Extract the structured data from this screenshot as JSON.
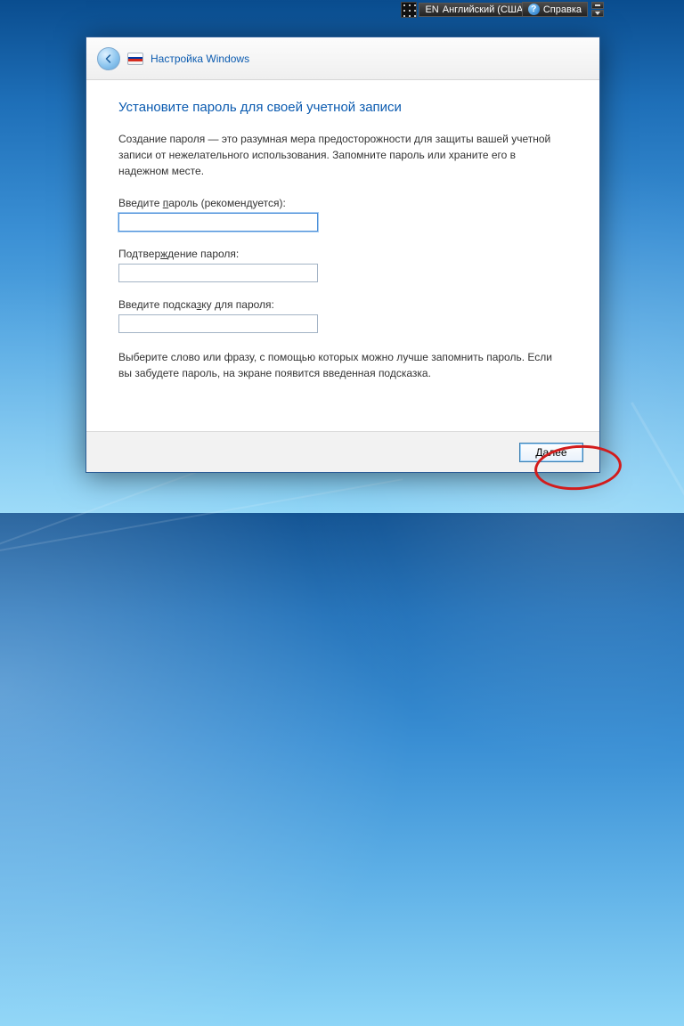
{
  "langbar": {
    "code": "EN",
    "language": "Английский (США)"
  },
  "help": {
    "label": "Справка"
  },
  "wizard": {
    "header_title": "Настройка Windows",
    "heading": "Установите пароль для своей учетной записи",
    "description": "Создание пароля — это разумная мера предосторожности для защиты вашей учетной записи от нежелательного использования. Запомните пароль или храните его в надежном месте.",
    "password": {
      "label_before": "Введите ",
      "label_ul": "п",
      "label_after": "ароль (рекомендуется):",
      "value": ""
    },
    "confirm": {
      "label_before": "Подтвер",
      "label_ul": "ж",
      "label_after": "дение пароля:",
      "value": ""
    },
    "hint": {
      "label_before": "Введите подска",
      "label_ul": "з",
      "label_after": "ку для пароля:",
      "value": ""
    },
    "hint_description": "Выберите слово или фразу, с помощью которых можно лучше запомнить пароль. Если вы забудете пароль, на экране появится введенная подсказка.",
    "next_button": "Далее"
  }
}
